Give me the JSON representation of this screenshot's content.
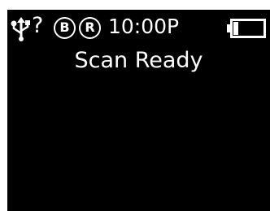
{
  "status_bar": {
    "icons": {
      "usb": "usb-icon",
      "unknown": "?",
      "battery": "battery-icon"
    },
    "badges": {
      "b": "B",
      "r": "R"
    },
    "time": "10:00P"
  },
  "main": {
    "message": "Scan Ready"
  },
  "colors": {
    "screen_background": "#000000",
    "foreground": "#ffffff",
    "page_background": "#ffffff"
  }
}
